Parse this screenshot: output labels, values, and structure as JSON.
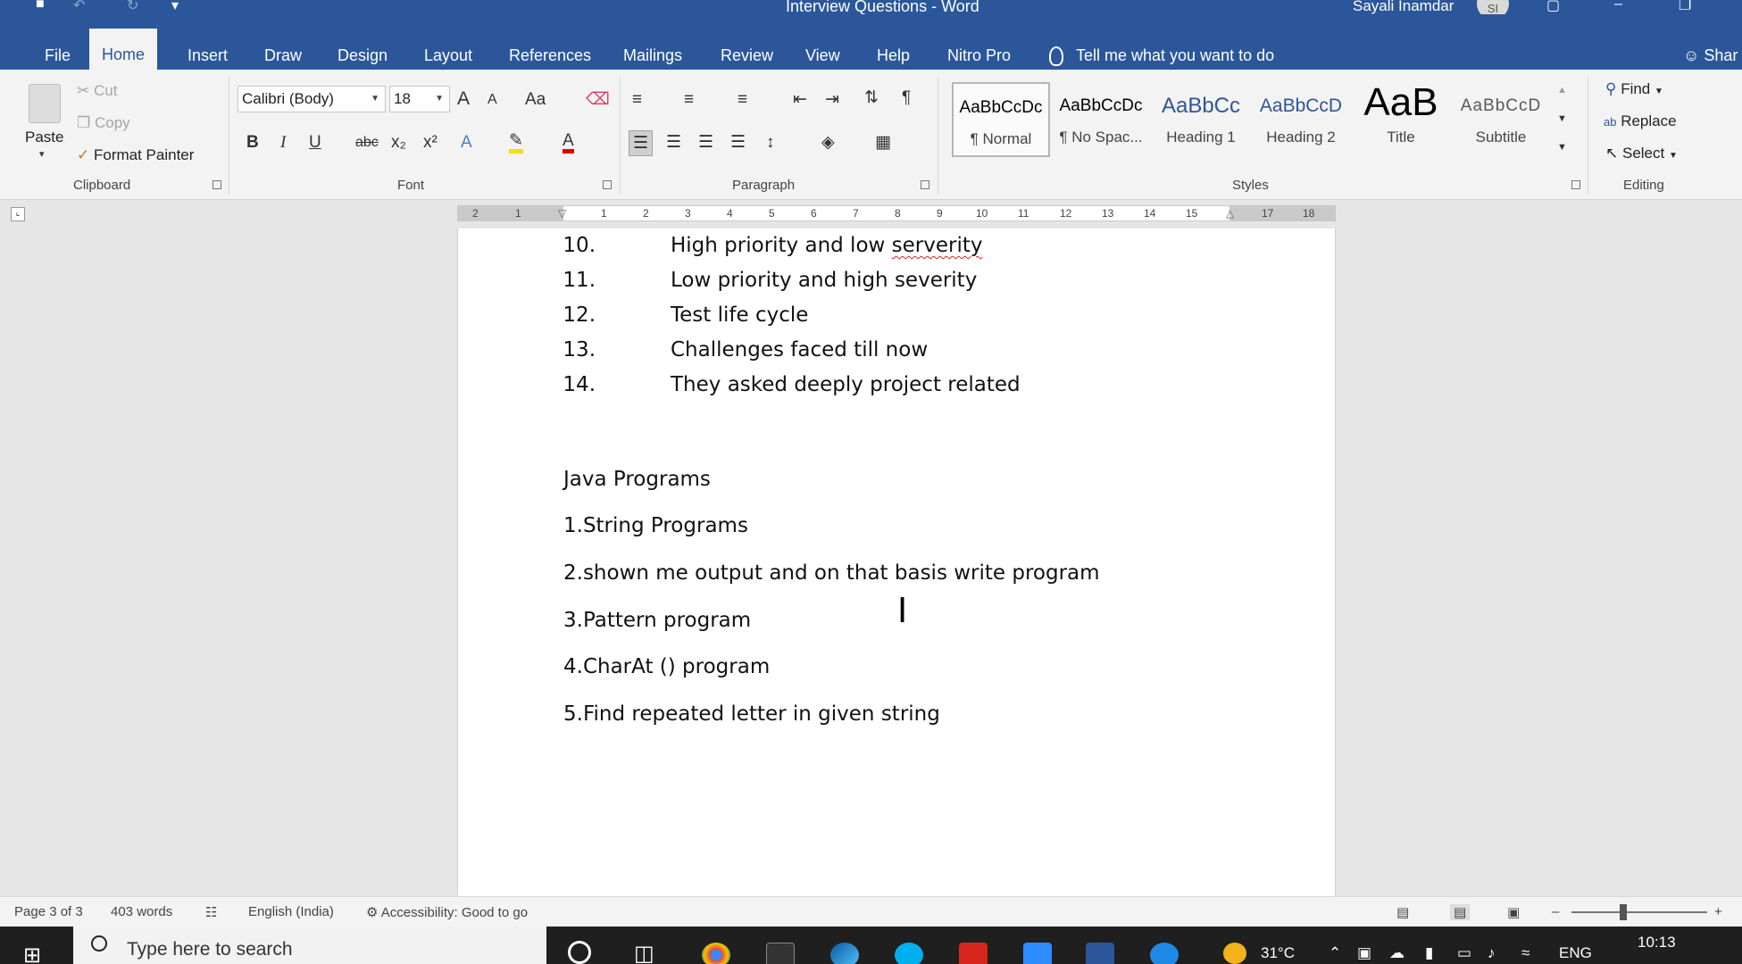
{
  "window": {
    "title": "Interview Questions  -  Word",
    "user": "Sayali Inamdar",
    "user_initials": "SI"
  },
  "tabs": [
    "File",
    "Home",
    "Insert",
    "Draw",
    "Design",
    "Layout",
    "References",
    "Mailings",
    "Review",
    "View",
    "Help",
    "Nitro Pro"
  ],
  "active_tab": "Home",
  "tell_me": "Tell me what you want to do",
  "share": "Shar",
  "clipboard": {
    "paste": "Paste",
    "cut": "Cut",
    "copy": "Copy",
    "format_painter": "Format Painter",
    "label": "Clipboard"
  },
  "font": {
    "family": "Calibri (Body)",
    "size": "18",
    "label": "Font",
    "bold": "B",
    "italic": "I",
    "underline": "U",
    "strike": "abc",
    "sub": "x₂",
    "sup": "x²",
    "change_case": "Aa",
    "grow": "A",
    "shrink": "A"
  },
  "paragraph": {
    "label": "Paragraph",
    "pilcrow": "¶"
  },
  "styles": {
    "label": "Styles",
    "items": [
      {
        "preview": "AaBbCcDc",
        "name": "¶ Normal"
      },
      {
        "preview": "AaBbCcDc",
        "name": "¶ No Spac..."
      },
      {
        "preview": "AaBbCc",
        "name": "Heading 1"
      },
      {
        "preview": "AaBbCcD",
        "name": "Heading 2"
      },
      {
        "preview": "AaB",
        "name": "Title"
      },
      {
        "preview": "AaBbCcD",
        "name": "Subtitle"
      }
    ]
  },
  "editing": {
    "find": "Find",
    "replace": "Replace",
    "select": "Select",
    "label": "Editing"
  },
  "ruler_numbers": [
    "2",
    "1",
    "1",
    "2",
    "3",
    "4",
    "5",
    "6",
    "7",
    "8",
    "9",
    "10",
    "11",
    "12",
    "13",
    "14",
    "15",
    "17",
    "18"
  ],
  "document": {
    "numbered": [
      {
        "n": "10.",
        "pre": "High priority and low ",
        "squiggle": "serverity"
      },
      {
        "n": "11.",
        "pre": "Low priority and high severity",
        "squiggle": ""
      },
      {
        "n": "12.",
        "pre": "Test life cycle",
        "squiggle": ""
      },
      {
        "n": "13.",
        "pre": "Challenges faced till now",
        "squiggle": ""
      },
      {
        "n": "14.",
        "pre": "They asked deeply project related",
        "squiggle": ""
      }
    ],
    "heading": "Java Programs",
    "lines": [
      "1.String Programs",
      "2.shown me output and on that basis write program",
      "3.Pattern program",
      "4.CharAt () program",
      "5.Find repeated letter in given string"
    ]
  },
  "status": {
    "page": "Page 3 of 3",
    "words": "403 words",
    "language": "English (India)",
    "accessibility": "Accessibility: Good to go"
  },
  "taskbar": {
    "search_placeholder": "Type here to search",
    "temp": "31°C",
    "lang": "ENG",
    "time": "10:13"
  },
  "colors": {
    "ribbon_blue": "#2b579a",
    "taskbar": "#1f1f1f"
  }
}
